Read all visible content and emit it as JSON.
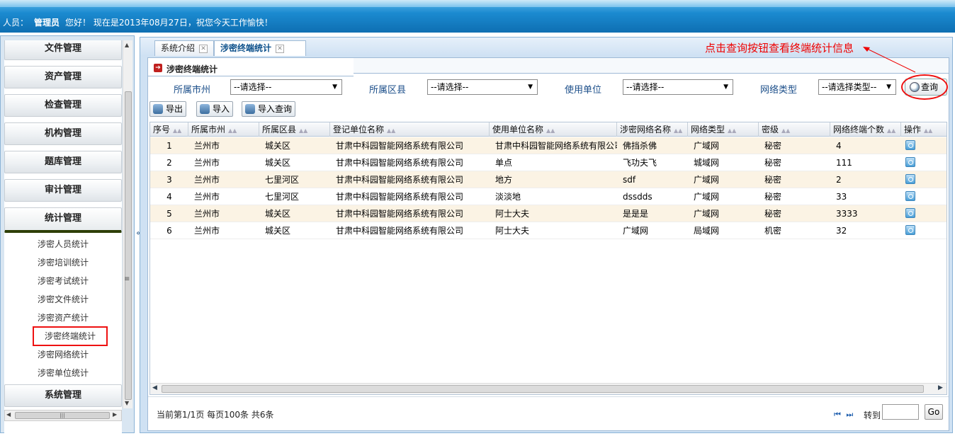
{
  "header": {
    "user_label": "人员：",
    "user_name": "管理员",
    "greeting": "您好！ 现在是2013年08月27日，祝您今天工作愉快！"
  },
  "sidebar": {
    "sections": [
      {
        "label": "文件管理"
      },
      {
        "label": "资产管理"
      },
      {
        "label": "检查管理"
      },
      {
        "label": "机构管理"
      },
      {
        "label": "题库管理"
      },
      {
        "label": "审计管理"
      },
      {
        "label": "统计管理"
      },
      {
        "label": "系统管理"
      }
    ],
    "sub_items": [
      {
        "label": "涉密人员统计"
      },
      {
        "label": "涉密培训统计"
      },
      {
        "label": "涉密考试统计"
      },
      {
        "label": "涉密文件统计"
      },
      {
        "label": "涉密资产统计"
      },
      {
        "label": "涉密终端统计"
      },
      {
        "label": "涉密网络统计"
      },
      {
        "label": "涉密单位统计"
      }
    ],
    "collapse_glyph": "«"
  },
  "tabs": [
    {
      "label": "系统介绍"
    },
    {
      "label": "涉密终端统计"
    }
  ],
  "annotation": "点击查询按钮查看终端统计信息",
  "panel": {
    "title": "涉密终端统计"
  },
  "filters": {
    "city_label": "所属市州",
    "city_value": "--请选择--",
    "district_label": "所属区县",
    "district_value": "--请选择--",
    "unit_label": "使用单位",
    "unit_value": "--请选择--",
    "nettype_label": "网络类型",
    "nettype_value": "--请选择类型--",
    "query_label": "查询"
  },
  "toolbar": {
    "export_label": "导出",
    "import_label": "导入",
    "import_query_label": "导入查询"
  },
  "table": {
    "columns": [
      "序号",
      "所属市州",
      "所属区县",
      "登记单位名称",
      "使用单位名称",
      "涉密网络名称",
      "网络类型",
      "密级",
      "网络终端个数",
      "操作"
    ],
    "rows": [
      [
        "1",
        "兰州市",
        "城关区",
        "甘肃中科园智能网络系统有限公司",
        "甘肃中科园智能网络系统有限公司",
        "佛挡杀佛",
        "广域网",
        "秘密",
        "4"
      ],
      [
        "2",
        "兰州市",
        "城关区",
        "甘肃中科园智能网络系统有限公司",
        "单点",
        "飞功夫飞",
        "城域网",
        "秘密",
        "111"
      ],
      [
        "3",
        "兰州市",
        "七里河区",
        "甘肃中科园智能网络系统有限公司",
        "地方",
        "sdf",
        "广域网",
        "秘密",
        "2"
      ],
      [
        "4",
        "兰州市",
        "七里河区",
        "甘肃中科园智能网络系统有限公司",
        "淡淡地",
        "dssdds",
        "广域网",
        "秘密",
        "33"
      ],
      [
        "5",
        "兰州市",
        "城关区",
        "甘肃中科园智能网络系统有限公司",
        "阿士大夫",
        "是是是",
        "广域网",
        "秘密",
        "3333"
      ],
      [
        "6",
        "兰州市",
        "城关区",
        "甘肃中科园智能网络系统有限公司",
        "阿士大夫",
        "广域网",
        "局域网",
        "机密",
        "32"
      ]
    ]
  },
  "pager": {
    "info": "当前第1/1页 每页100条 共6条",
    "nav": "⏮ ⏭",
    "goto_label": "转到",
    "go_label": "Go"
  },
  "colors": {
    "header_blue": "#1b8ad0",
    "hint_red": "#e00000",
    "row_highlight": "#fbf3e4"
  }
}
